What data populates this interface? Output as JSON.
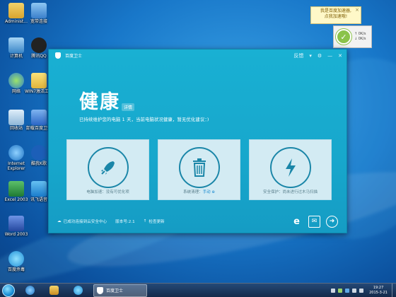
{
  "desktop": {
    "icons": [
      {
        "label": "Administ...",
        "icon": "user-folder-icon",
        "color": "#e6b93a"
      },
      {
        "label": "宽带连接",
        "icon": "network-connection-icon",
        "color": "#4a8fd6"
      },
      {
        "label": "计算机",
        "icon": "computer-icon",
        "color": "#5aa0d8"
      },
      {
        "label": "腾讯QQ",
        "icon": "qq-icon",
        "color": "#222222"
      },
      {
        "label": "网络",
        "icon": "network-icon",
        "color": "#3c8ad0"
      },
      {
        "label": "WIN7激活工具",
        "icon": "folder-icon",
        "color": "#e8c14a"
      },
      {
        "label": "回收站",
        "icon": "recycle-bin-icon",
        "color": "#b9d3e8"
      },
      {
        "label": "卸载百度卫士",
        "icon": "uninstall-shield-icon",
        "color": "#3f7fd8"
      },
      {
        "label": "Internet Explorer",
        "icon": "ie-icon",
        "color": "#2e8bd8"
      },
      {
        "label": "酷我K歌",
        "icon": "kuwo-icon",
        "color": "#1c5fb8"
      },
      {
        "label": "Excel 2003",
        "icon": "excel-icon",
        "color": "#2b8a3e"
      },
      {
        "label": "讯飞语音",
        "icon": "voice-icon",
        "color": "#2a8fd6"
      },
      {
        "label": "Word 2003",
        "icon": "word-icon",
        "color": "#2b57b3"
      },
      {
        "label": "百度杀毒",
        "icon": "baidu-antivirus-icon",
        "color": "#2d9ee0"
      }
    ]
  },
  "popup": {
    "line1": "我是百度加速器,",
    "line2": "点我加速哦!",
    "close": "×"
  },
  "widget": {
    "up": "0K/s",
    "down": "0K/s",
    "check": "✓"
  },
  "window": {
    "title": "百度卫士",
    "controls": {
      "feedback": "反馈",
      "menu": "▾",
      "settings": "⚙",
      "minimize": "—",
      "close": "✕"
    },
    "hero": {
      "title": "健康",
      "detail": "详情",
      "subtitle": "已持续维护您的电脑 1 天，当前电脑状况健康，暂无优化建议：)"
    },
    "cards": [
      {
        "icon": "rocket-icon",
        "caption": "电脑加速：没有可优化项",
        "link": ""
      },
      {
        "icon": "trash-icon",
        "caption": "系统清理：",
        "link": "手动 ⊕"
      },
      {
        "icon": "lightning-icon",
        "caption": "安全保护：尚未进行过木马扫描",
        "link": ""
      }
    ],
    "bottom": {
      "cloud": "已成功连接到云安全中心",
      "version": "版本号:2.1",
      "update": "检查更新"
    }
  },
  "taskbar": {
    "active_task": "百度卫士",
    "time": "19:27",
    "date": "2015-3-21"
  },
  "colors": {
    "window_bg": "#17a7cc",
    "card_bg": "#d3ebf3",
    "accent": "#1a86a8"
  }
}
